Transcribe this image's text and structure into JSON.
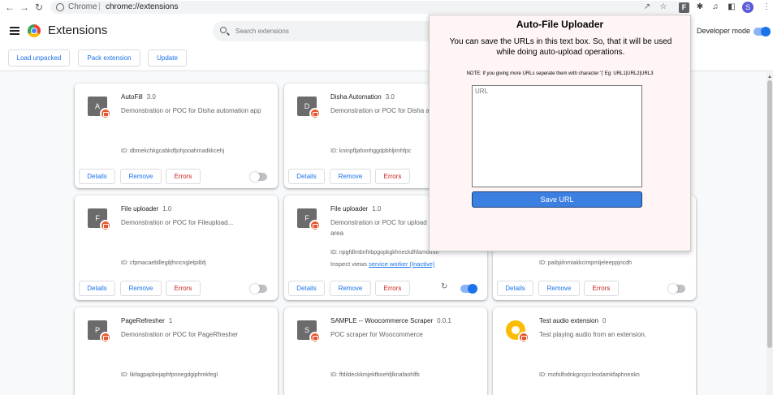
{
  "browser": {
    "scheme_label": "Chrome",
    "separator": "|",
    "url": "chrome://extensions",
    "profile_initial": "S",
    "toolbar_ext_letter": "F"
  },
  "header": {
    "title": "Extensions",
    "search_placeholder": "Search extensions",
    "developer_mode_label": "Developer mode",
    "developer_mode_on": true,
    "load_unpacked": "Load unpacked",
    "pack_extension": "Pack extension",
    "update": "Update"
  },
  "buttons": {
    "details": "Details",
    "remove": "Remove",
    "errors": "Errors"
  },
  "extensions": [
    {
      "icon_letter": "A",
      "name": "AutoFill",
      "version": "3.0",
      "description": "Demonstration or POC for Disha automation app",
      "id": "ID: dbmekchkgcabkdfjohjooahmadkkcehj",
      "enabled": false
    },
    {
      "icon_letter": "D",
      "name": "Disha Automation",
      "version": "3.0",
      "description": "Demonstration or POC for Disha automat",
      "id": "ID: kninpfljahonhggdpbhljimhfpc",
      "enabled": null
    },
    {
      "icon_letter": "F",
      "name": "File uploader",
      "version": "1.0",
      "description": "Demonstration or POC for Fileupload...",
      "id": "ID: cfpmacaeblllegiljfnncnglelpilbfj",
      "enabled": false
    },
    {
      "icon_letter": "F",
      "name": "File uploader",
      "version": "1.0",
      "description": "Demonstration or POC for upload market place area",
      "id": "ID: npgfdlmbnfnbpgopkgkhneckdhfamomm",
      "inspect_prefix": "Inspect views",
      "inspect_link": "service worker (Inactive)",
      "enabled": true
    },
    {
      "icon_letter": "",
      "name": "",
      "version": "",
      "description": "",
      "id": "ID: paibjiilnmiakkcimpmljeleeppjncdh",
      "enabled": false
    },
    {
      "icon_letter": "P",
      "name": "PageRefresher",
      "version": "1",
      "description": "Demonstration or POC for PageRfresher",
      "id": "ID: likfagpapbnjaphfpnnegdgiphmkfegl"
    },
    {
      "icon_letter": "S",
      "name": "SAMPLE -- Woocommerce Scraper",
      "version": "0.0.1",
      "description": "POC scraper for Woocommerce",
      "id": "ID: ffdildeckkmjekfboehfjlknafaohlfb"
    },
    {
      "icon_letter": "",
      "name": "Test audio extension",
      "version": "0",
      "description": "Test playing audio from an extension.",
      "id": "ID: mofolfodnkgccjccleodamkfaphneokn"
    }
  ],
  "popup": {
    "title": "Auto-File Uploader",
    "text": "You can save the URLs in this text box. So, that it will be used while doing auto-upload operations.",
    "note": "NOTE: If you giving more URLs seperate them with character '|' Eg: URL1|URL2|URL3",
    "textarea_placeholder": "URL",
    "save_label": "Save URL"
  }
}
